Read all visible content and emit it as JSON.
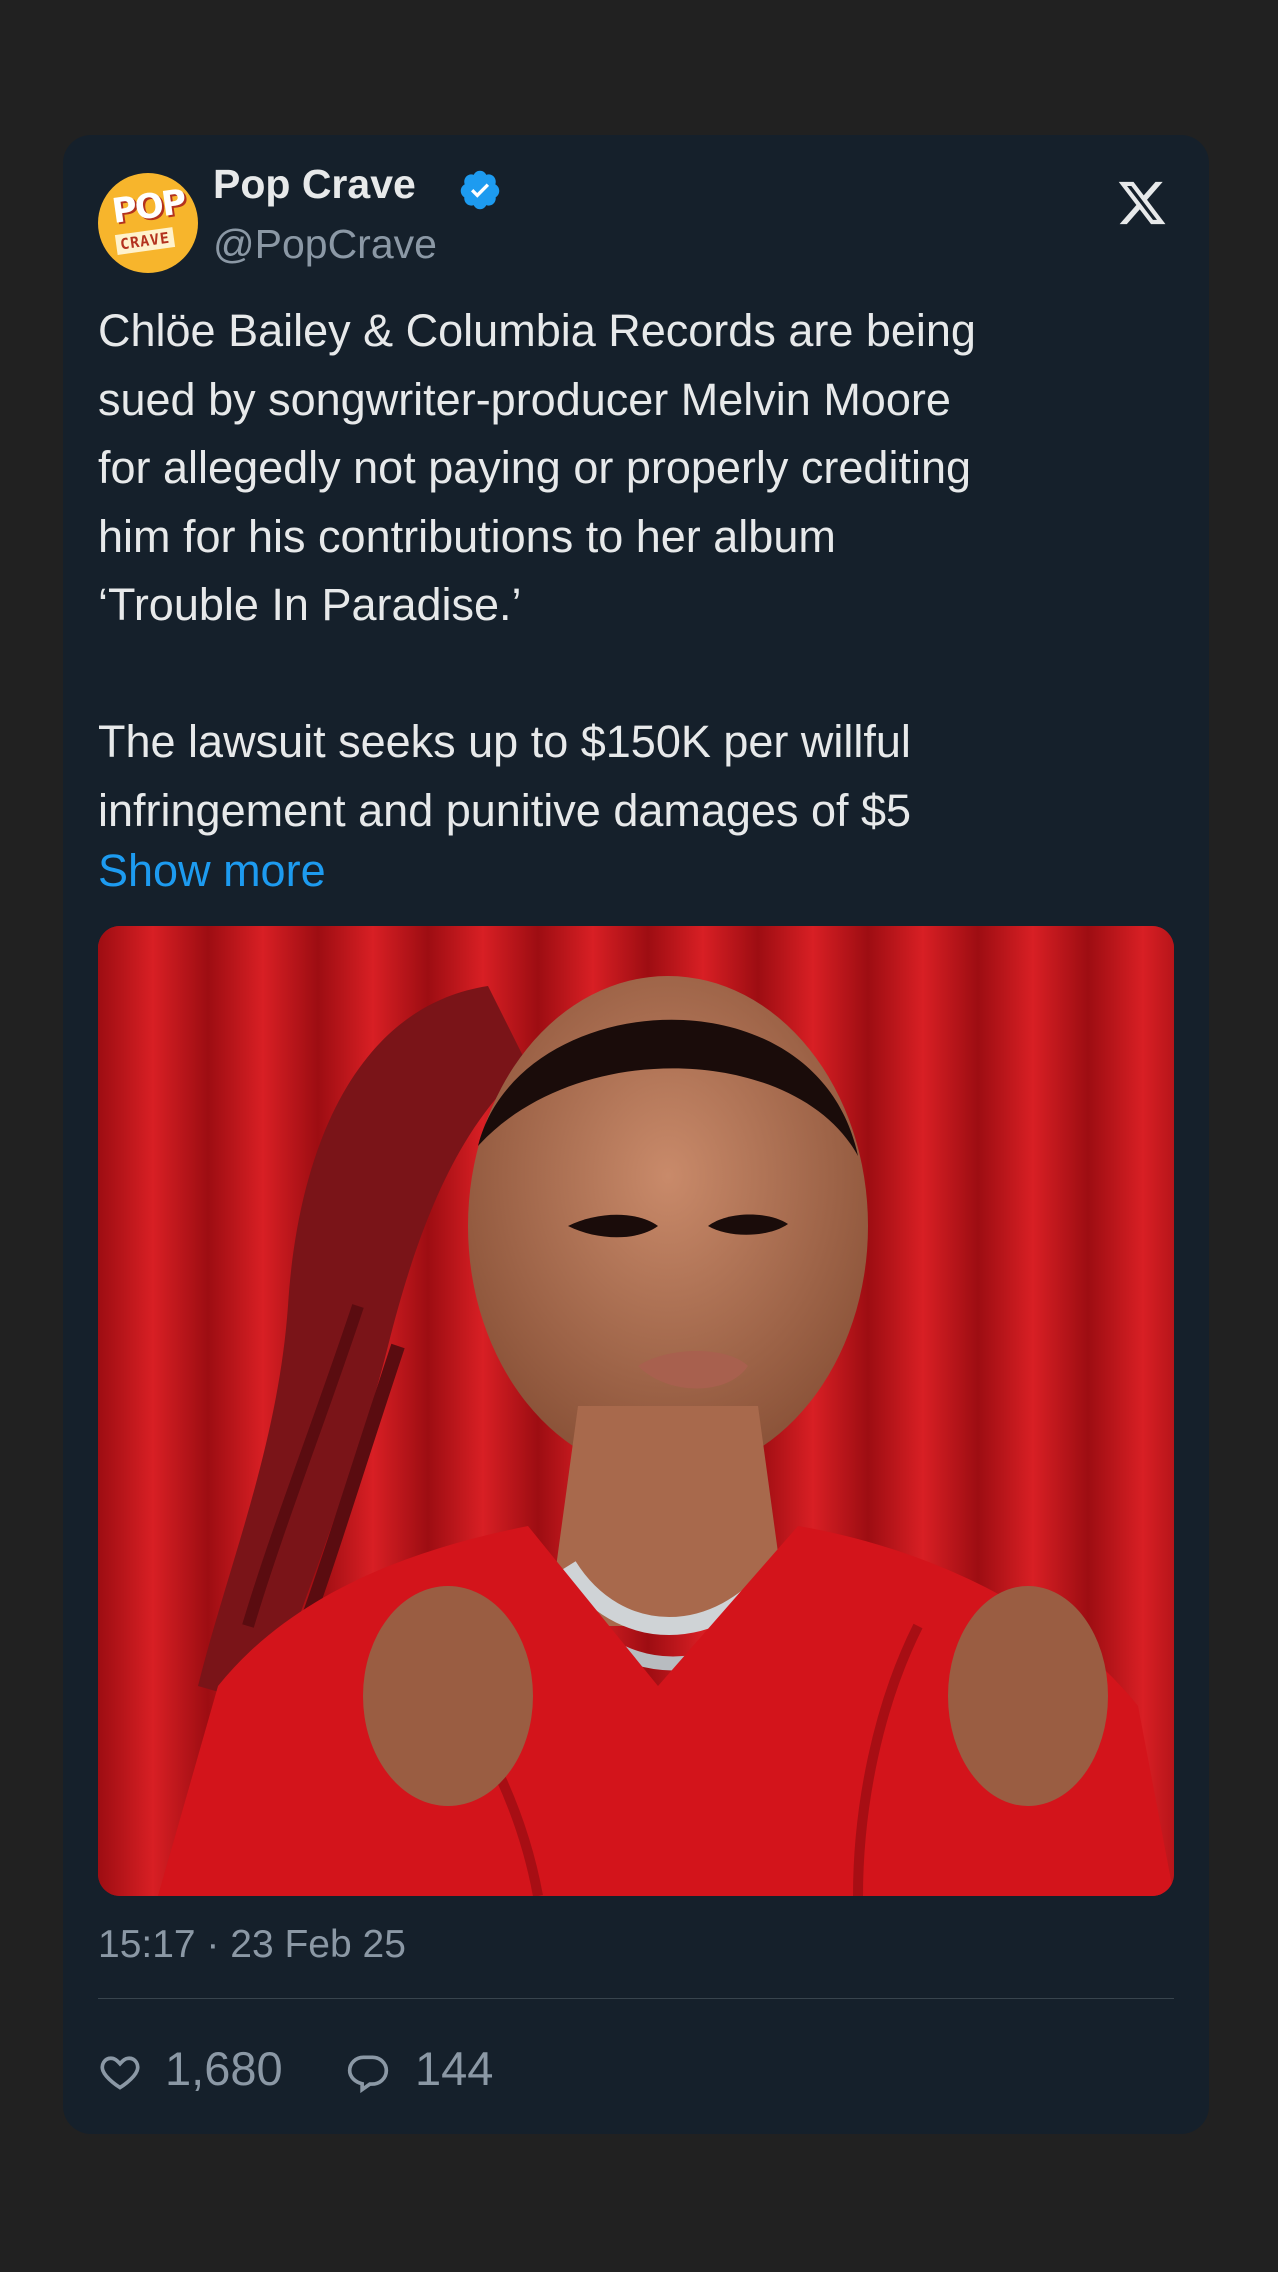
{
  "tweet": {
    "author": {
      "display_name": "Pop Crave",
      "handle": "@PopCrave",
      "verified": true,
      "avatar_text_top": "POP",
      "avatar_text_bottom": "CRAVE"
    },
    "platform_icon": "x-logo-icon",
    "text_lines": [
      "Chlöe Bailey & Columbia Records are being",
      "sued by songwriter-producer Melvin Moore",
      "for allegedly not paying or properly crediting",
      "him for his contributions to her album",
      "‘Trouble In Paradise.’",
      "",
      "The lawsuit seeks up to $150K per willful",
      "infringement and punitive damages of $5"
    ],
    "show_more_label": "Show more",
    "media_image_icon": "photo-icon",
    "timestamp": "15:17 · 23 Feb 25",
    "likes": "1,680",
    "replies": "144"
  },
  "colors": {
    "page_bg": "#212121",
    "card_bg": "#15202b",
    "text_primary": "#e7e9ea",
    "text_secondary": "#8b98a5",
    "link": "#1d9bf0",
    "verified": "#1d9bf0",
    "divider": "#38444d"
  }
}
